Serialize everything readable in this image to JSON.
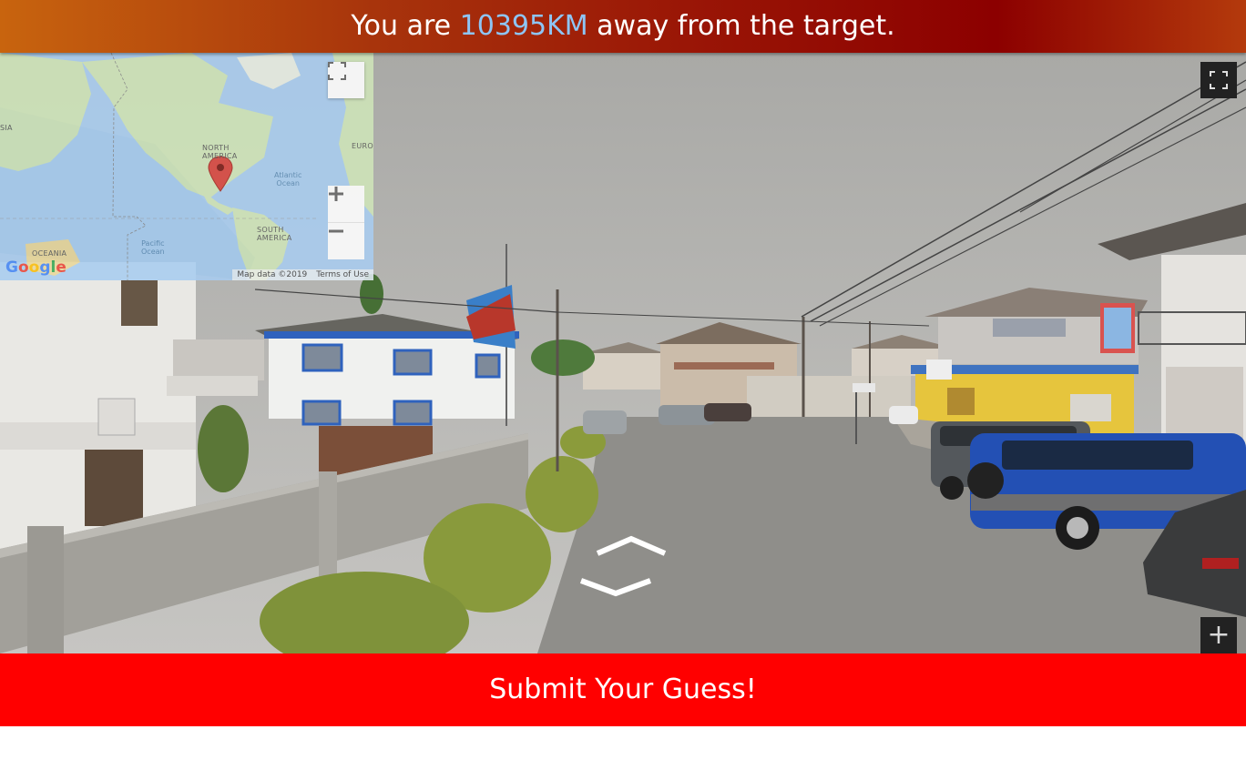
{
  "banner": {
    "prefix": "You are ",
    "distance": "10395KM",
    "suffix": " away from the target."
  },
  "mini_map": {
    "labels": {
      "north_america": "NORTH\nAMERICA",
      "south_america": "SOUTH\nAMERICA",
      "oceania": "OCEANIA",
      "europe": "EURO",
      "asia": "SIA",
      "atlantic": "Atlantic\nOcean",
      "pacific": "Pacific\nOcean"
    },
    "logo": "Google",
    "map_data": "Map data ©2019",
    "terms": "Terms of Use"
  },
  "street_view": {
    "zoom_label": "+"
  },
  "submit": {
    "label": "Submit Your Guess!"
  },
  "colors": {
    "submit_bg": "#ff0000",
    "distance_text": "#8ec5f5",
    "banner_start": "#c8640e",
    "banner_end": "#8c0000"
  },
  "icons": [
    "fullscreen-icon",
    "map-pin-icon",
    "plus-icon",
    "minus-icon",
    "chevron-up-icon",
    "chevron-down-icon"
  ]
}
